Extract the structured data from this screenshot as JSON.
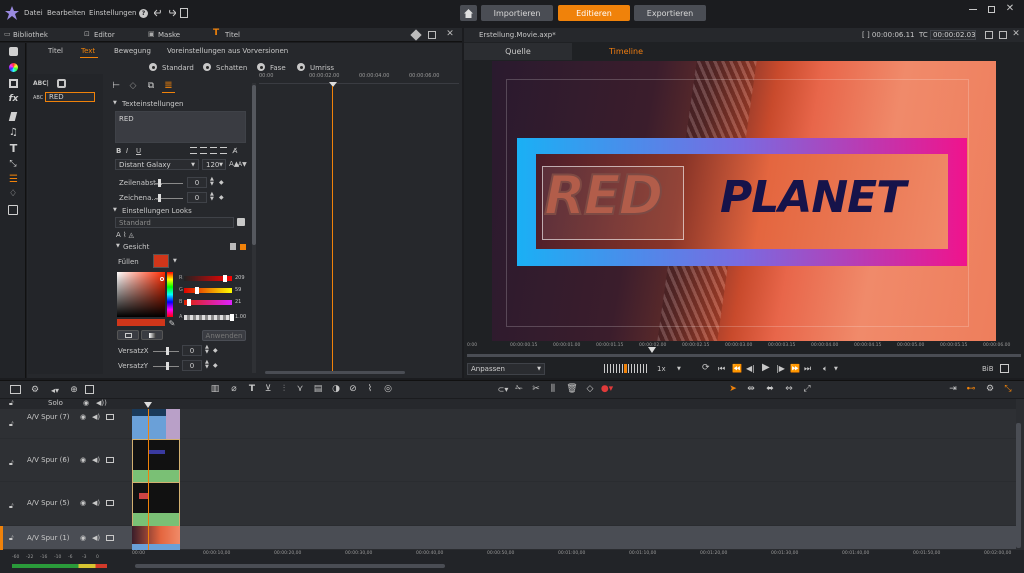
{
  "menu": {
    "file": "Datei",
    "edit": "Bearbeiten",
    "settings": "Einstellungen"
  },
  "top_tabs": {
    "import": "Importieren",
    "edit": "Editieren",
    "export": "Exportieren"
  },
  "lib_tabs": {
    "library": "Bibliothek",
    "editor": "Editor",
    "mask": "Maske",
    "title": "Titel"
  },
  "title_tabs": {
    "title": "Titel",
    "text": "Text",
    "motion": "Bewegung",
    "presets": "Voreinstellungen aus Vorversionen"
  },
  "styles": {
    "standard": "Standard",
    "shadow": "Schatten",
    "bevel": "Fase",
    "outline": "Umriss"
  },
  "layers": {
    "abc_label": "ABC|",
    "row_prefix": "ABC",
    "row_name": "RED"
  },
  "mini_ruler": [
    "00:00",
    "00:00:02.00",
    "00:00:04.00",
    "00:00:06.00"
  ],
  "text_settings": {
    "header": "Texteinstellungen",
    "text": "RED",
    "font": "Distant Galaxy",
    "size": "120",
    "line_spacing_label": "Zeilenabst...",
    "line_spacing_value": "0",
    "char_spacing_label": "Zeichena...",
    "char_spacing_value": "0"
  },
  "looks": {
    "header": "Einstellungen Looks",
    "preset": "Standard",
    "face_header": "Gesicht",
    "fill_label": "Füllen",
    "fill_color": "#d0361a"
  },
  "rgb": {
    "r": "209",
    "g": "59",
    "b": "21",
    "a": "1.00"
  },
  "apply_button": "Anwenden",
  "offsets": {
    "x_label": "VersatzX",
    "x_value": "0",
    "y_label": "VersatzY",
    "y_value": "0"
  },
  "preview": {
    "file": "Erstellung.Movie.axp*",
    "dur_label": "[ ] 00:00:06.11",
    "tc_label": "TC",
    "tc_value": "00:00:02.03",
    "tab_source": "Quelle",
    "tab_timeline": "Timeline",
    "word1": "RED",
    "word2": "PLANET",
    "fit": "Anpassen",
    "speed": "1x",
    "bib": "BiB"
  },
  "preview_ruler": [
    "0:00",
    "00:00:00.15",
    "00:00:01.00",
    "00:00:01.15",
    "00:00:02.00",
    "00:00:02.15",
    "00:00:03.00",
    "00:00:03.15",
    "00:00:04.00",
    "00:00:04.15",
    "00:00:05.00",
    "00:00:05.15",
    "00:00:06.00"
  ],
  "tracks": {
    "solo": "Solo",
    "items": [
      {
        "name": "A/V Spur (7)"
      },
      {
        "name": "A/V Spur (6)"
      },
      {
        "name": "A/V Spur (5)"
      },
      {
        "name": "A/V Spur (1)"
      }
    ]
  },
  "meter_labels": [
    "-60",
    "-22",
    "-16",
    "-10",
    "-6",
    "-3",
    "0"
  ],
  "timeline_ruler": [
    "00:00",
    "00:00:10,00",
    "00:00:20,00",
    "00:00:30,00",
    "00:00:40,00",
    "00:00:50,00",
    "00:01:00,00",
    "00:01:10,00",
    "00:01:20,00",
    "00:01:30,00",
    "00:01:40,00",
    "00:01:50,00",
    "00:02:00,00"
  ],
  "colors": {
    "accent": "#f0820a",
    "active_tab": "#ef7d11",
    "gradient_start": "#1ab0f5",
    "gradient_end": "#f0138c",
    "planet_text": "#16134a"
  }
}
